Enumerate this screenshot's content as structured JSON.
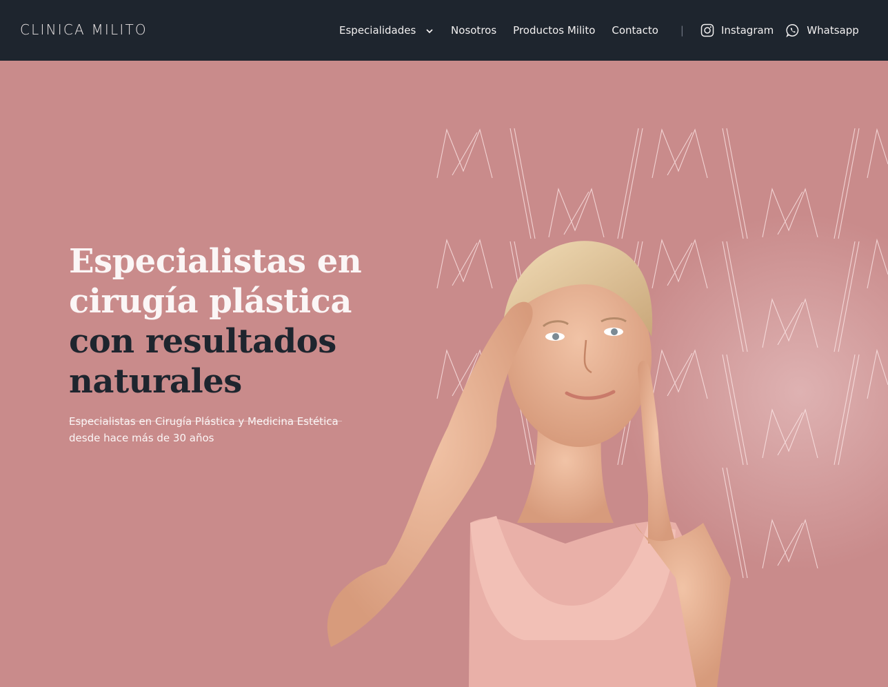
{
  "header": {
    "logo": "CLINICA MILITO",
    "nav": [
      {
        "label": "Especialidades",
        "has_dropdown": true
      },
      {
        "label": "Nosotros"
      },
      {
        "label": "Productos Milito"
      },
      {
        "label": "Contacto"
      }
    ],
    "separator": "|",
    "social": [
      {
        "label": "Instagram",
        "icon": "instagram-icon"
      },
      {
        "label": "Whatsapp",
        "icon": "whatsapp-icon"
      }
    ]
  },
  "hero": {
    "headline_light": [
      "Especialistas en",
      "cirugía plástica"
    ],
    "headline_dark": [
      "con resultados",
      "naturales"
    ],
    "subtitle_line1": "Especialistas en Cirugía Plástica y Medicina Estética",
    "subtitle_line2": "desde hace más de 30 años"
  },
  "colors": {
    "header_bg": "#1e252e",
    "hero_bg": "#c98b8b",
    "headline_light": "#fbf6f6",
    "headline_dark": "#1e252e"
  }
}
